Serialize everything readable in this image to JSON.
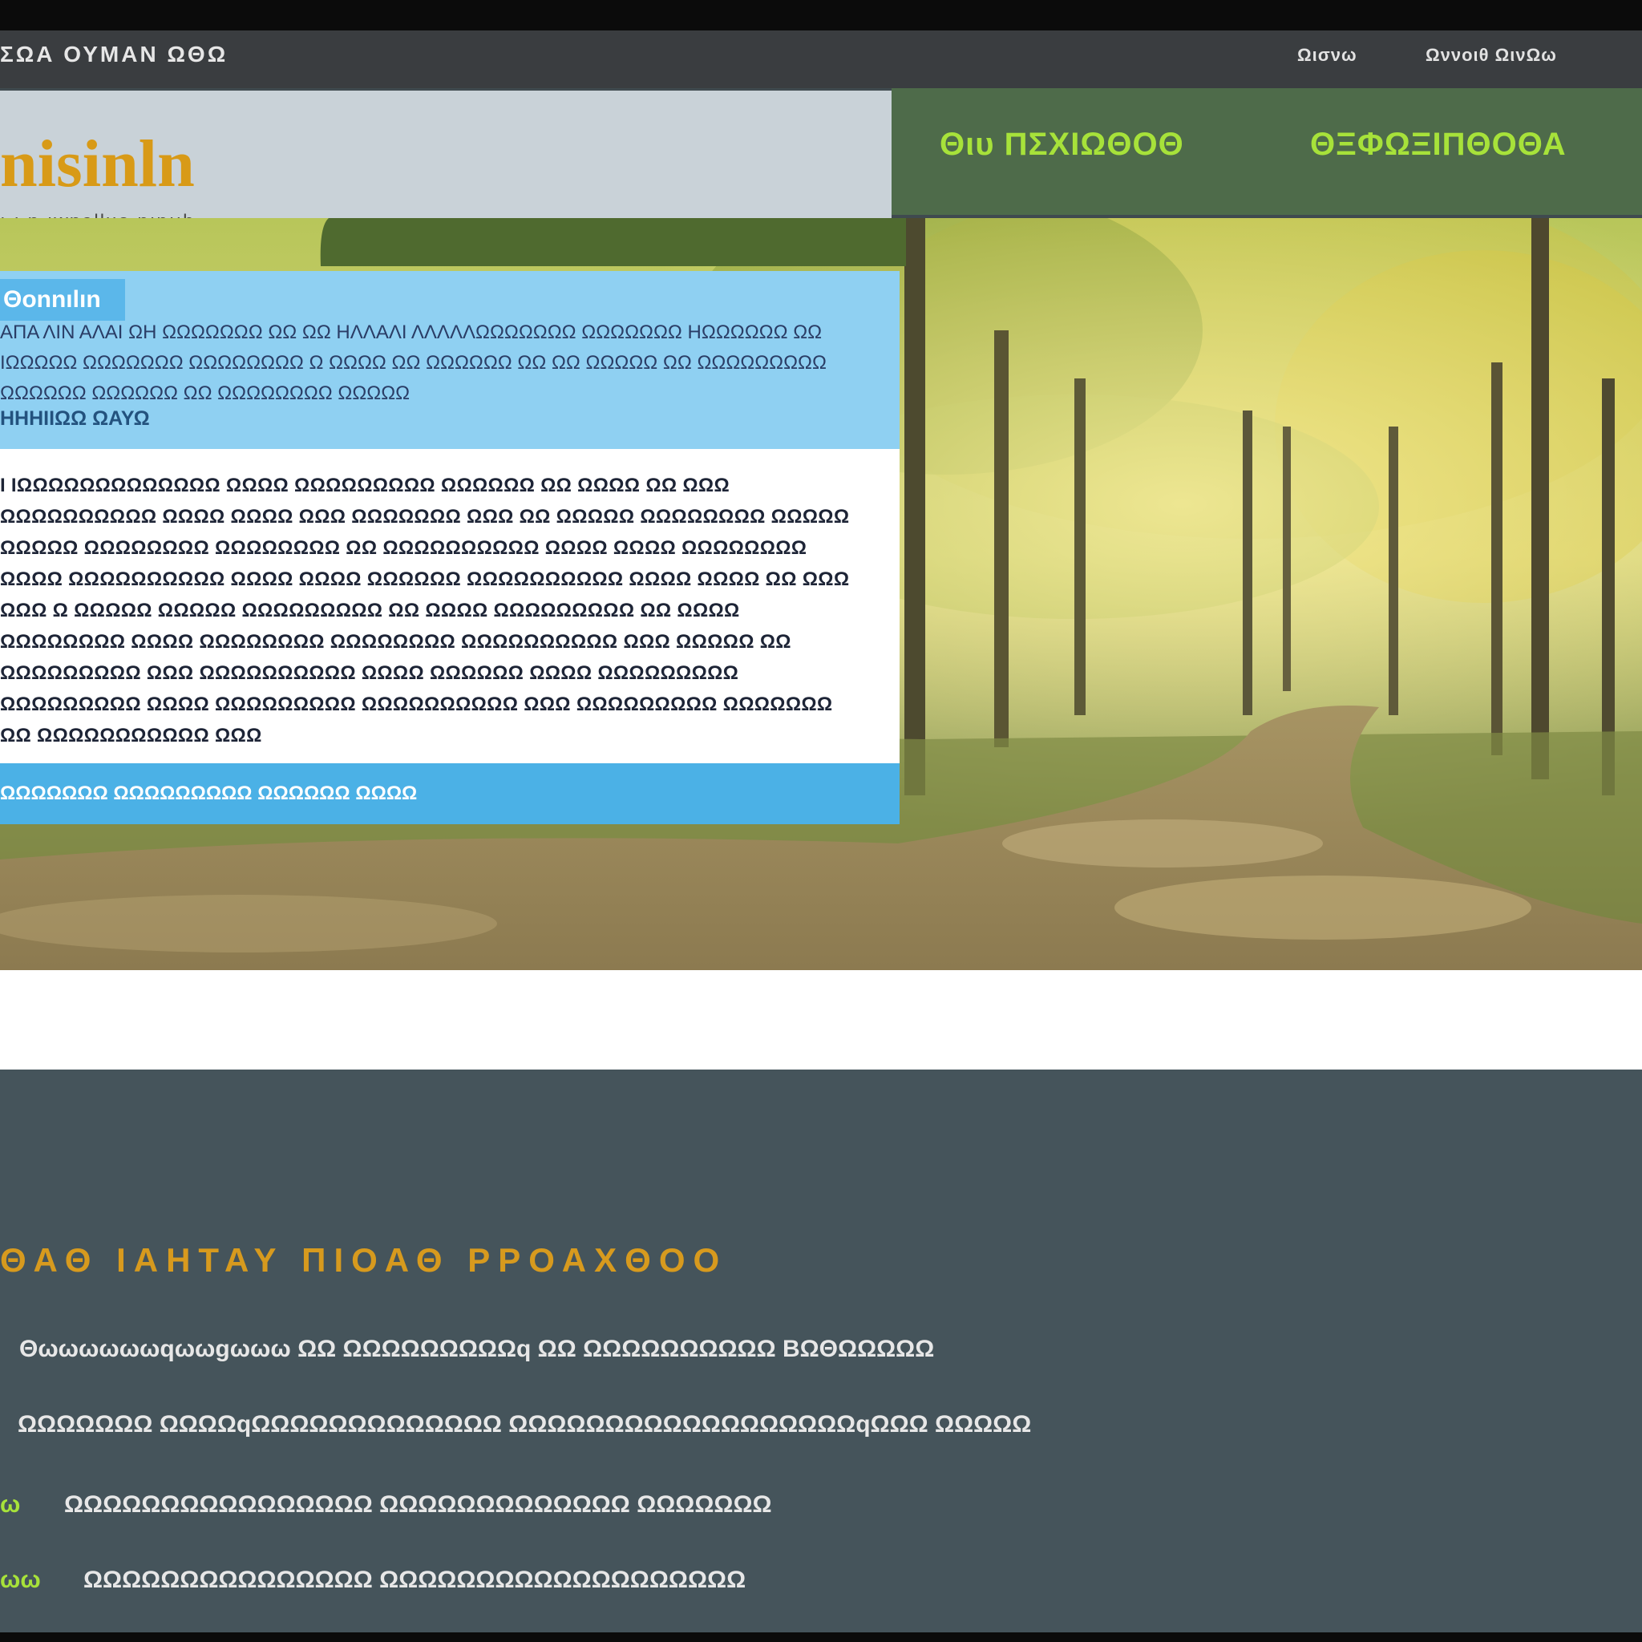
{
  "topbar": {
    "brand": "ΣΩΑ ΟΥΜΑΝ ΩΘΩ",
    "links": [
      "Ωισνω",
      "Ωννοιθ ΩινΩω"
    ]
  },
  "header": {
    "title": "nisinln",
    "tagline": "ı ı n ıwnalluo nınııh",
    "nav": [
      "Θιυ ΠΣΧΙΩΘΟΘ",
      "ΘΞΦΩΞΙΠΘΟΘΑ"
    ]
  },
  "panel": {
    "tab": "Θonnılın",
    "lead": "ΑΠΑ ΛΙΝ ΑΛΑΙ ΩΗ ΩΩΩΩΩΩΩ ΩΩ ΩΩ ΗΛΛΑΛΙ ΛΛΛΛΛΩΩΩΩΩΩΩ ΩΩΩΩΩΩΩ ΗΩΩΩΩΩΩ ΩΩ ΙΩΩΩΩΩ ΩΩΩΩΩΩΩ ΩΩΩΩΩΩΩΩ Ω ΩΩΩΩ ΩΩ ΩΩΩΩΩΩ ΩΩ ΩΩ ΩΩΩΩΩ ΩΩ ΩΩΩΩΩΩΩΩΩ ΩΩΩΩΩΩ ΩΩΩΩΩΩ ΩΩ ΩΩΩΩΩΩΩΩ ΩΩΩΩΩ",
    "subtitle": "ΗΗΗΙΙΩΩ ΩΑΥΩ",
    "body": "Ι ΙΩΩΩΩΩΩΩΩΩΩΩΩΩ ΩΩΩΩ ΩΩΩΩΩΩΩΩΩ ΩΩΩΩΩΩ ΩΩ ΩΩΩΩ ΩΩ ΩΩΩ ΩΩΩΩΩΩΩΩΩΩ ΩΩΩΩ ΩΩΩΩ ΩΩΩ ΩΩΩΩΩΩΩ ΩΩΩ ΩΩ ΩΩΩΩΩ ΩΩΩΩΩΩΩΩ ΩΩΩΩΩ ΩΩΩΩΩ ΩΩΩΩΩΩΩΩ ΩΩΩΩΩΩΩΩ ΩΩ ΩΩΩΩΩΩΩΩΩΩ ΩΩΩΩ ΩΩΩΩ ΩΩΩΩΩΩΩΩ ΩΩΩΩ ΩΩΩΩΩΩΩΩΩΩ ΩΩΩΩ ΩΩΩΩ ΩΩΩΩΩΩ ΩΩΩΩΩΩΩΩΩΩ ΩΩΩΩ ΩΩΩΩ ΩΩ ΩΩΩ ΩΩΩ Ω ΩΩΩΩΩ ΩΩΩΩΩ ΩΩΩΩΩΩΩΩΩ ΩΩ ΩΩΩΩ ΩΩΩΩΩΩΩΩΩ ΩΩ ΩΩΩΩ ΩΩΩΩΩΩΩΩ ΩΩΩΩ ΩΩΩΩΩΩΩΩ ΩΩΩΩΩΩΩΩ ΩΩΩΩΩΩΩΩΩΩ ΩΩΩ ΩΩΩΩΩ ΩΩ ΩΩΩΩΩΩΩΩΩ ΩΩΩ ΩΩΩΩΩΩΩΩΩΩ ΩΩΩΩ ΩΩΩΩΩΩ ΩΩΩΩ ΩΩΩΩΩΩΩΩΩ ΩΩΩΩΩΩΩΩΩ ΩΩΩΩ ΩΩΩΩΩΩΩΩΩ ΩΩΩΩΩΩΩΩΩΩ ΩΩΩ ΩΩΩΩΩΩΩΩΩ ΩΩΩΩΩΩΩ ΩΩ ΩΩΩΩΩΩΩΩΩΩΩ ΩΩΩ",
    "footer": "ΩΩΩΩΩΩΩ ΩΩΩΩΩΩΩΩΩ ΩΩΩΩΩΩ ΩΩΩΩ"
  },
  "section": {
    "heading": "ΘΑΘ ΙΑΗΤΑΥ ΠΙΟΑΘ ΡΡΟΑΧΘΟΟ",
    "items": [
      {
        "mark": "",
        "text": "Θωωωωωωqωωgωωω ΩΩ ΩΩΩΩΩΩΩΩΩq ΩΩ ΩΩΩΩΩΩΩΩΩΩ ΒΩΘΩΩΩΩΩ"
      },
      {
        "mark": "",
        "text": "ΩΩΩΩΩΩΩ ΩΩΩΩqΩΩΩΩΩΩΩΩΩΩΩΩΩ ΩΩΩΩΩΩΩΩΩΩΩΩΩΩΩΩΩΩqΩΩΩ ΩΩΩΩΩ"
      },
      {
        "mark": "ω",
        "text": "ΩΩΩΩΩΩΩΩΩΩΩΩΩΩΩΩ ΩΩΩΩΩΩΩΩΩΩΩΩΩ ΩΩΩΩΩΩΩ"
      },
      {
        "mark": "ωω",
        "text": "ΩΩΩΩΩΩΩΩΩΩΩΩΩΩΩ ΩΩΩΩΩΩΩΩΩΩΩΩΩΩΩΩΩΩΩ"
      }
    ]
  },
  "colors": {
    "accent_green": "#a7e23a",
    "accent_gold": "#d89a17",
    "panel_blue": "#8fd0f2",
    "header_green": "#4e6b4a"
  }
}
